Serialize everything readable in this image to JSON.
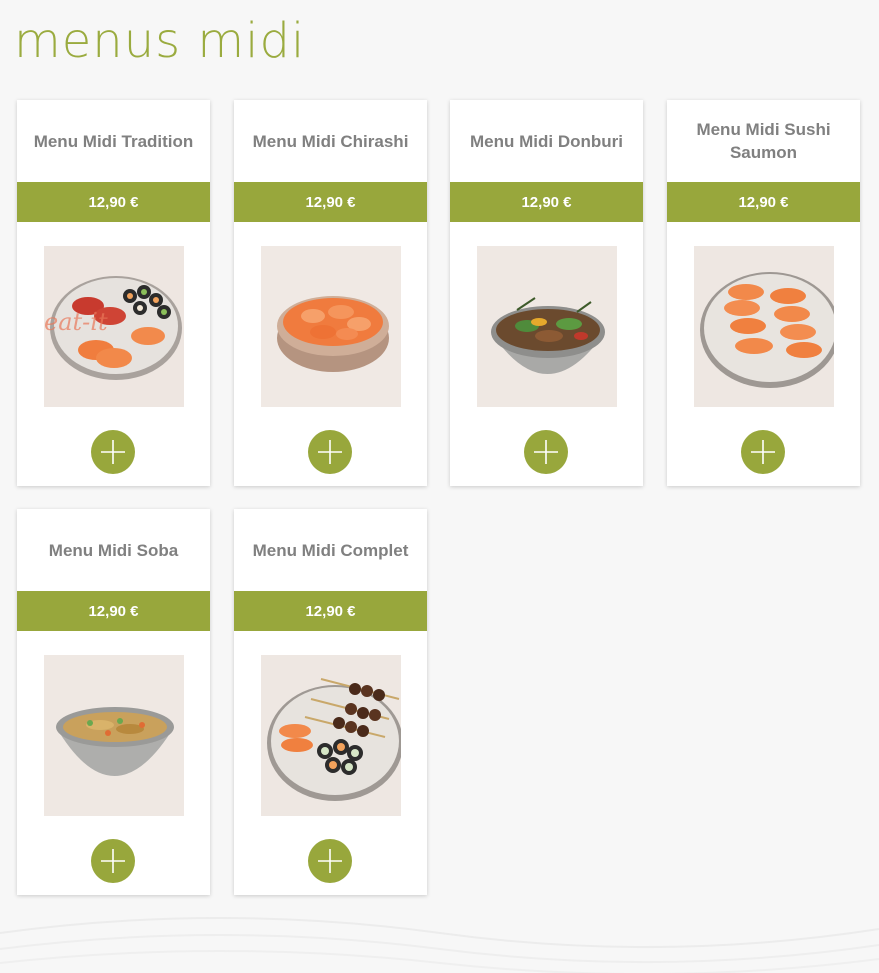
{
  "page": {
    "title": "menus midi"
  },
  "menus": [
    {
      "title": "Menu Midi Tradition",
      "price": "12,90 €",
      "dish": "nigiri-maki-plate-photo",
      "watermark": "eat-it"
    },
    {
      "title": "Menu Midi Chirashi",
      "price": "12,90 €",
      "dish": "chirashi-bowl-photo"
    },
    {
      "title": "Menu Midi Donburi",
      "price": "12,90 €",
      "dish": "donburi-bowl-photo"
    },
    {
      "title": "Menu Midi Sushi Saumon",
      "price": "12,90 €",
      "dish": "salmon-sushi-plate-photo"
    },
    {
      "title": "Menu Midi Soba",
      "price": "12,90 €",
      "dish": "soba-bowl-photo"
    },
    {
      "title": "Menu Midi Complet",
      "price": "12,90 €",
      "dish": "yakitori-sushi-plate-photo"
    }
  ],
  "icons": {
    "add": "plus-icon"
  },
  "colors": {
    "accent": "#98a73c",
    "title": "#9aab3f",
    "card_text": "#808080",
    "background": "#f7f7f7"
  }
}
